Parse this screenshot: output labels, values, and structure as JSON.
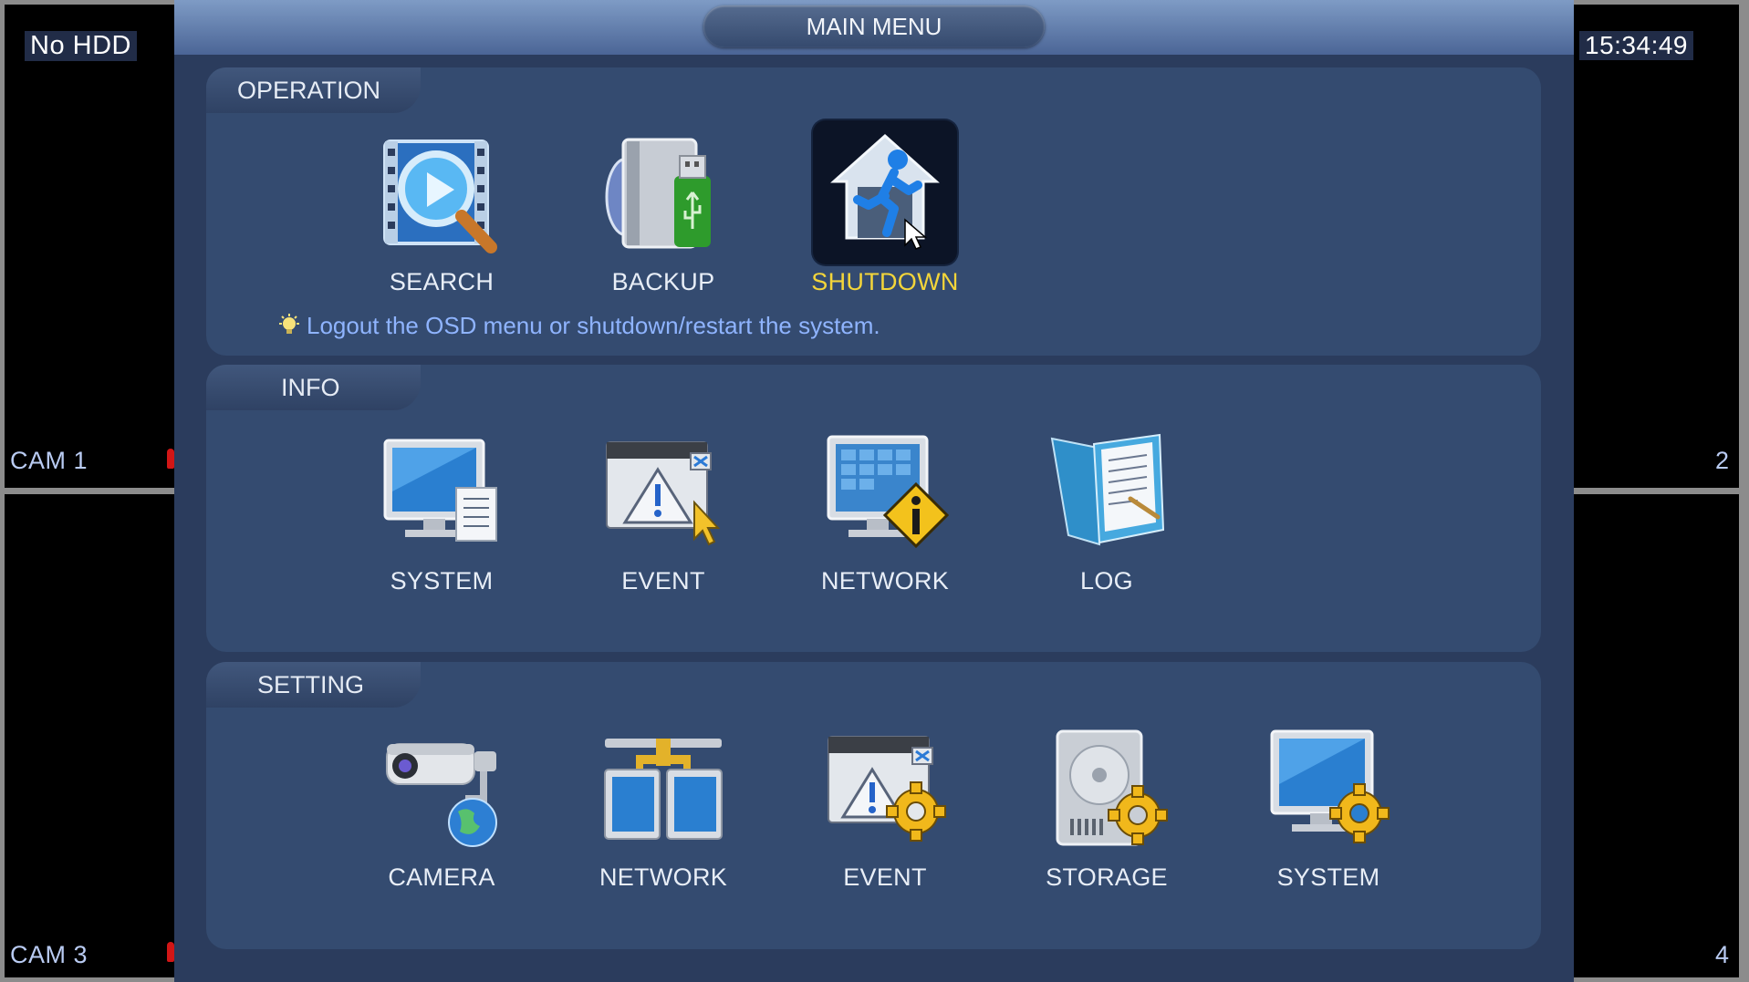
{
  "osd": {
    "hdd_status": "No HDD",
    "time": "15:34:49",
    "cam1_label": "CAM 1",
    "cam2_label": "2",
    "cam3_label": "CAM 3",
    "cam4_label": "4"
  },
  "menu": {
    "title": "MAIN MENU",
    "operation": {
      "heading": "OPERATION",
      "items": [
        {
          "label": "SEARCH",
          "icon": "search-icon"
        },
        {
          "label": "BACKUP",
          "icon": "backup-icon"
        },
        {
          "label": "SHUTDOWN",
          "icon": "shutdown-icon",
          "selected": true
        }
      ],
      "hint": "Logout the OSD menu or shutdown/restart the system."
    },
    "info": {
      "heading": "INFO",
      "items": [
        {
          "label": "SYSTEM",
          "icon": "system-info-icon"
        },
        {
          "label": "EVENT",
          "icon": "event-info-icon"
        },
        {
          "label": "NETWORK",
          "icon": "network-info-icon"
        },
        {
          "label": "LOG",
          "icon": "log-icon"
        }
      ]
    },
    "setting": {
      "heading": "SETTING",
      "items": [
        {
          "label": "CAMERA",
          "icon": "camera-icon"
        },
        {
          "label": "NETWORK",
          "icon": "network-setting-icon"
        },
        {
          "label": "EVENT",
          "icon": "event-setting-icon"
        },
        {
          "label": "STORAGE",
          "icon": "storage-icon"
        },
        {
          "label": "SYSTEM",
          "icon": "system-setting-icon"
        }
      ]
    }
  },
  "colors": {
    "window_bg": "#2b3c5d",
    "section_bg": "#344b70",
    "active_label": "#f3d53a",
    "hint_text": "#8fb4ff"
  }
}
